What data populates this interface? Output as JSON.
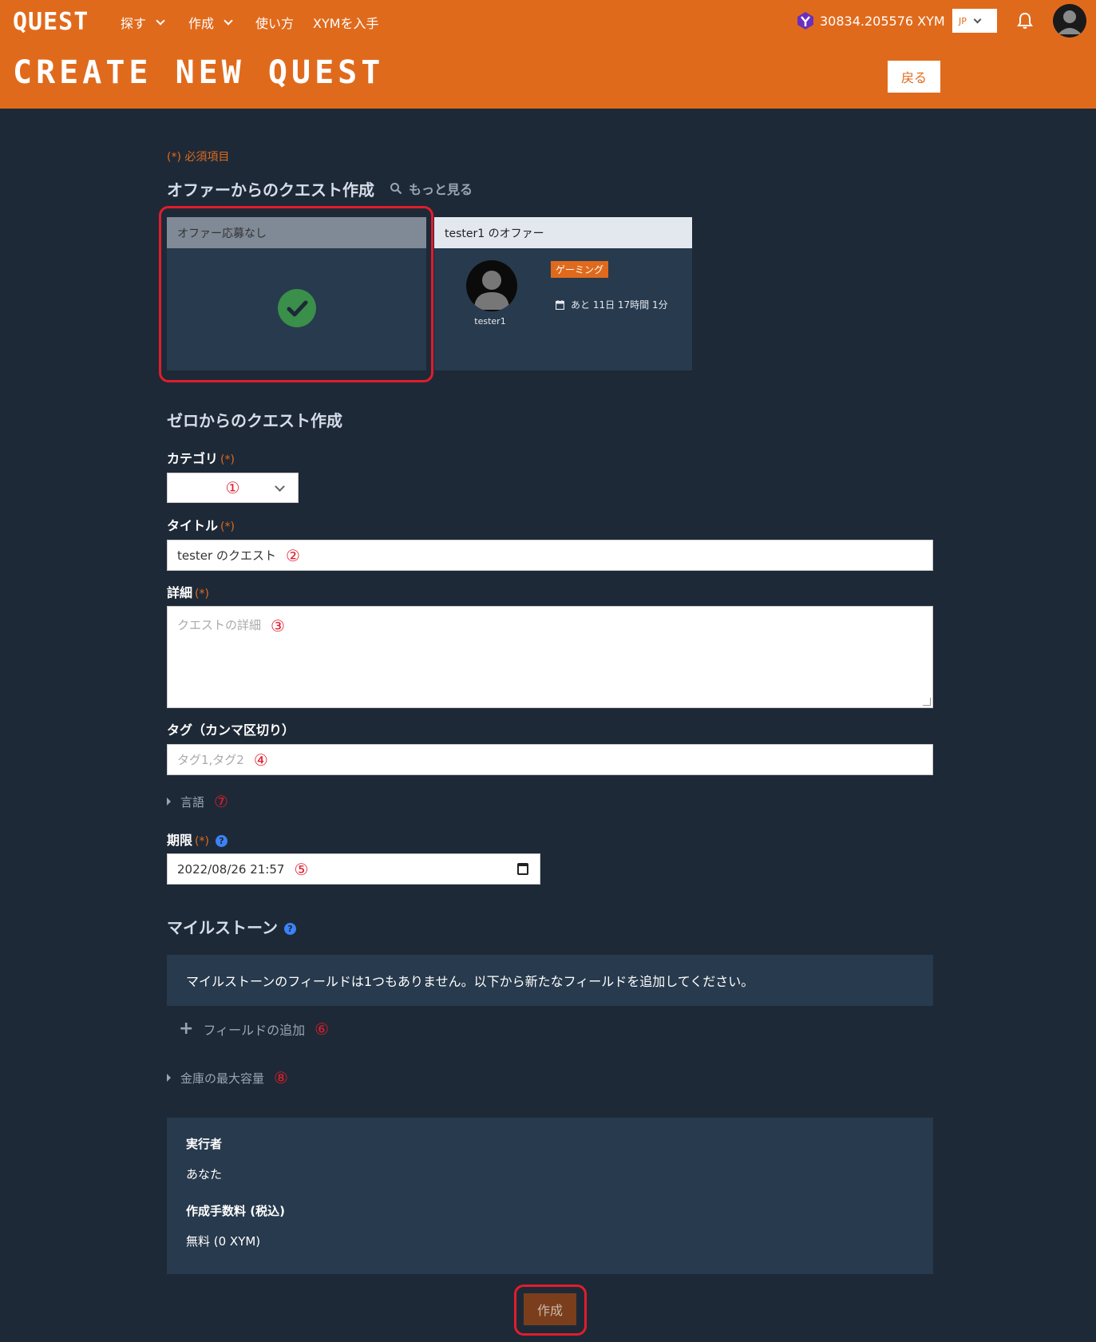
{
  "header": {
    "logo": "QUEST",
    "nav": [
      "探す",
      "作成",
      "使い方",
      "XYMを入手"
    ],
    "balance": "30834.205576 XYM",
    "lang": "JP",
    "page_title": "CREATE NEW QUEST",
    "back_label": "戻る"
  },
  "required_note": "(*) 必須項目",
  "offer_section": {
    "title": "オファーからのクエスト作成",
    "more_label": "もっと見る",
    "none_card_title": "オファー応募なし",
    "offer_card": {
      "title": "tester1 のオファー",
      "user": "tester1",
      "tag": "ゲーミング",
      "deadline": "あと 11日 17時間 1分"
    }
  },
  "scratch_section": {
    "title": "ゼロからのクエスト作成"
  },
  "form": {
    "category": {
      "label": "カテゴリ",
      "req": "(*)",
      "marker": "①"
    },
    "title": {
      "label": "タイトル",
      "req": "(*)",
      "value": "tester のクエスト",
      "marker": "②"
    },
    "detail": {
      "label": "詳細",
      "req": "(*)",
      "placeholder": "クエストの詳細",
      "marker": "③"
    },
    "tags": {
      "label": "タグ（カンマ区切り）",
      "placeholder": "タグ1,タグ2",
      "marker": "④"
    },
    "language": {
      "label": "言語",
      "marker": "⑦"
    },
    "deadline": {
      "label": "期限",
      "req": "(*)",
      "value": "2022/08/26 21:57",
      "marker": "⑤"
    },
    "help_glyph": "?"
  },
  "milestone": {
    "title": "マイルストーン",
    "empty_text": "マイルストーンのフィールドは1つもありません。以下から新たなフィールドを追加してください。",
    "add_label": "フィールドの追加",
    "add_marker": "⑥",
    "plus_glyph": "+",
    "vault_label": "金庫の最大容量",
    "vault_marker": "⑧"
  },
  "summary": {
    "executor_label": "実行者",
    "executor_value": "あなた",
    "fee_label": "作成手数料 (税込)",
    "fee_value": "無料 (0 XYM)"
  },
  "create_label": "作成",
  "colors": {
    "brand": "#e06a1c",
    "bg": "#1e2937",
    "panel": "#283a4d",
    "highlight": "#e11d2b"
  }
}
